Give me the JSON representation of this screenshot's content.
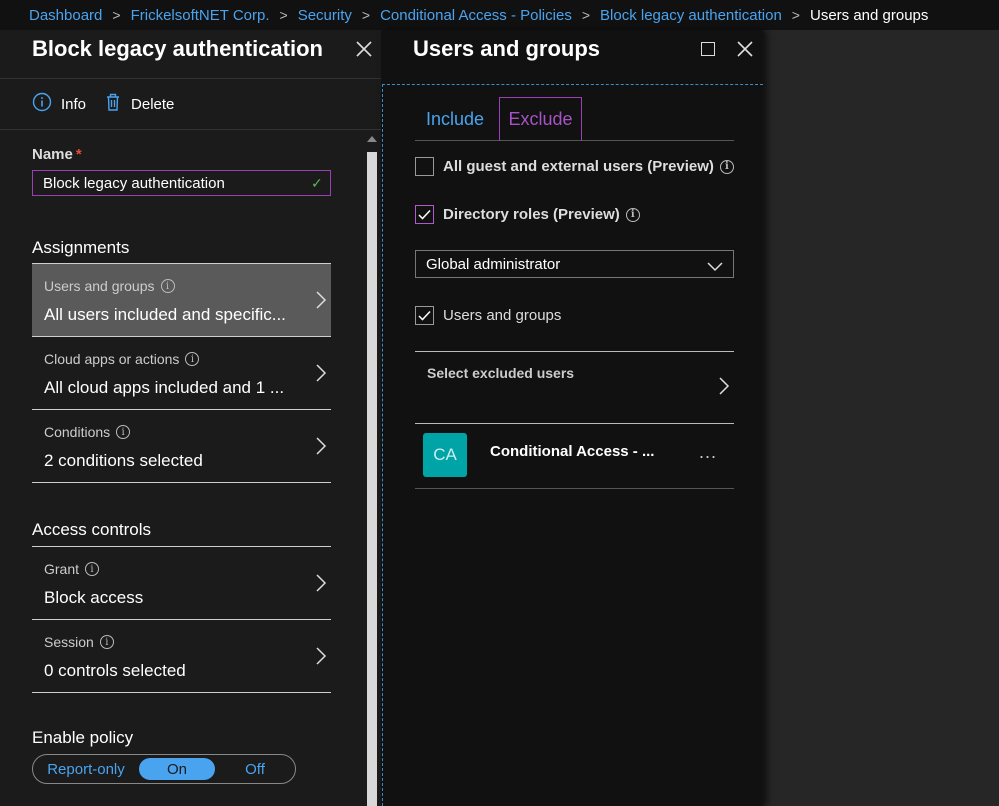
{
  "breadcrumb": {
    "items": [
      "Dashboard",
      "FrickelsoftNET Corp.",
      "Security",
      "Conditional Access - Policies",
      "Block legacy authentication"
    ],
    "current": "Users and groups"
  },
  "left_blade": {
    "title": "Block legacy authentication",
    "toolbar": {
      "info_label": "Info",
      "delete_label": "Delete"
    },
    "name_label": "Name",
    "required_mark": "*",
    "name_value": "Block legacy authentication",
    "assignments_heading": "Assignments",
    "assignments": [
      {
        "label": "Users and groups",
        "value": "All users included and specific..."
      },
      {
        "label": "Cloud apps or actions",
        "value": "All cloud apps included and 1 ..."
      },
      {
        "label": "Conditions",
        "value": "2 conditions selected"
      }
    ],
    "access_heading": "Access controls",
    "access": [
      {
        "label": "Grant",
        "value": "Block access"
      },
      {
        "label": "Session",
        "value": "0 controls selected"
      }
    ],
    "enable_heading": "Enable policy",
    "toggle": {
      "options": [
        "Report-only",
        "On",
        "Off"
      ],
      "selected": "On"
    }
  },
  "right_blade": {
    "title": "Users and groups",
    "tabs": {
      "include": "Include",
      "exclude": "Exclude",
      "active": "Exclude"
    },
    "checkboxes": [
      {
        "label": "All guest and external users (Preview)",
        "checked": false
      },
      {
        "label": "Directory roles (Preview)",
        "checked": true
      },
      {
        "label": "Users and groups",
        "checked": true
      }
    ],
    "dropdown_value": "Global administrator",
    "select_label": "Select excluded users",
    "items": [
      {
        "initials": "CA",
        "name": "Conditional Access - ...",
        "more": "..."
      }
    ]
  },
  "colors": {
    "link": "#4aa3ef",
    "accent_purple": "#9b3fb5",
    "avatar_teal": "#00a3a6",
    "valid_green": "#5cb85c",
    "required_red": "#e74c3c"
  },
  "icons": [
    "info-icon",
    "trash-icon",
    "close-icon",
    "maximize-icon",
    "chevron-right-icon",
    "chevron-down-icon",
    "checkmark-icon",
    "more-icon"
  ]
}
